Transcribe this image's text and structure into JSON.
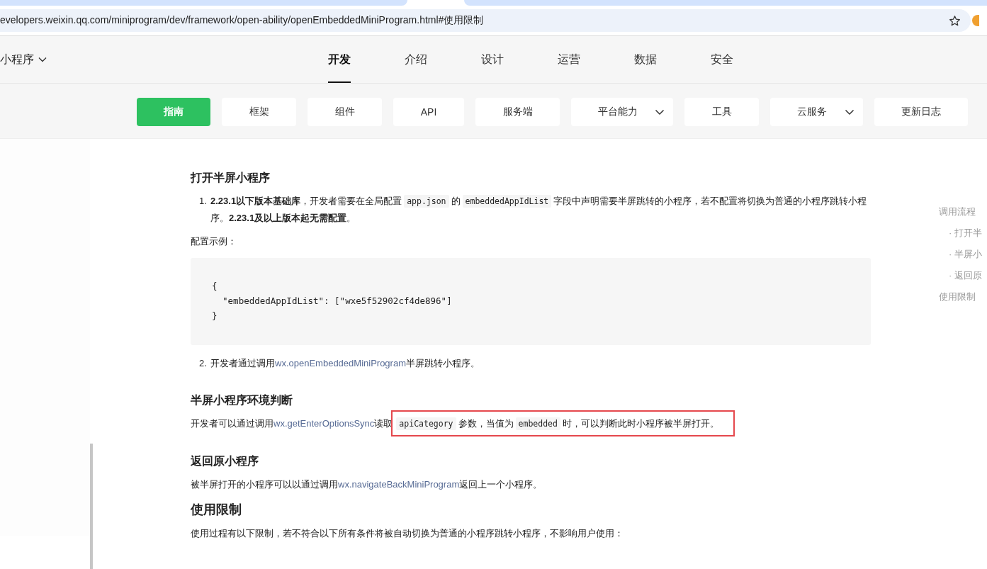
{
  "browser": {
    "url": "evelopers.weixin.qq.com/miniprogram/dev/framework/open-ability/openEmbeddedMiniProgram.html#使用限制"
  },
  "header": {
    "product": "小程序",
    "nav": [
      {
        "label": "开发",
        "selected": true
      },
      {
        "label": "介绍",
        "selected": false
      },
      {
        "label": "设计",
        "selected": false
      },
      {
        "label": "运营",
        "selected": false
      },
      {
        "label": "数据",
        "selected": false
      },
      {
        "label": "安全",
        "selected": false
      }
    ],
    "subnav": [
      {
        "label": "指南",
        "selected": true,
        "dropdown": false
      },
      {
        "label": "框架",
        "selected": false,
        "dropdown": false
      },
      {
        "label": "组件",
        "selected": false,
        "dropdown": false
      },
      {
        "label": "API",
        "selected": false,
        "dropdown": false
      },
      {
        "label": "服务端",
        "selected": false,
        "dropdown": false
      },
      {
        "label": "平台能力",
        "selected": false,
        "dropdown": true
      },
      {
        "label": "工具",
        "selected": false,
        "dropdown": false
      },
      {
        "label": "云服务",
        "selected": false,
        "dropdown": true
      },
      {
        "label": "更新日志",
        "selected": false,
        "dropdown": false
      }
    ]
  },
  "content": [
    {
      "kind": "h3",
      "text": "打开半屏小程序"
    },
    {
      "kind": "item",
      "number": "1.",
      "segments": [
        {
          "kind": "bold",
          "text": "2.23.1以下版本基础库"
        },
        {
          "kind": "text",
          "text": "，开发者需要在全局配置"
        },
        {
          "kind": "code",
          "text": "app.json"
        },
        {
          "kind": "text",
          "text": "的"
        },
        {
          "kind": "code",
          "text": "embeddedAppIdList"
        },
        {
          "kind": "text",
          "text": "字段中声明需要半屏跳转的小程序，若不配置将切换为普通的小程序跳转小程序。"
        },
        {
          "kind": "bold",
          "text": "2.23.1及以上版本起无需配置"
        },
        {
          "kind": "text",
          "text": "。"
        }
      ]
    },
    {
      "kind": "para",
      "segments": [
        {
          "kind": "text",
          "text": "配置示例："
        }
      ]
    },
    {
      "kind": "codeblock",
      "text": "{\n  \"embeddedAppIdList\": [\"wxe5f52902cf4de896\"]\n}"
    },
    {
      "kind": "item",
      "number": "2.",
      "segments": [
        {
          "kind": "text",
          "text": "开发者通过调用"
        },
        {
          "kind": "link",
          "text": "wx.openEmbeddedMiniProgram"
        },
        {
          "kind": "text",
          "text": "半屏跳转小程序。"
        }
      ]
    },
    {
      "kind": "h3",
      "text": "半屏小程序环境判断"
    },
    {
      "kind": "para",
      "segments": [
        {
          "kind": "text",
          "text": "开发者可以通过调用"
        },
        {
          "kind": "link",
          "text": "wx.getEnterOptionsSync"
        },
        {
          "kind": "text",
          "text": "读取"
        }
      ],
      "highlighted_segments": [
        {
          "kind": "code",
          "text": "apiCategory"
        },
        {
          "kind": "text",
          "text": "参数，当值为"
        },
        {
          "kind": "code",
          "text": "embedded"
        },
        {
          "kind": "text",
          "text": "时，可以判断此时小程序被半屏打开。"
        }
      ]
    },
    {
      "kind": "h3",
      "text": "返回原小程序"
    },
    {
      "kind": "para",
      "segments": [
        {
          "kind": "text",
          "text": "被半屏打开的小程序可以以通过调用"
        },
        {
          "kind": "link",
          "text": "wx.navigateBackMiniProgram"
        },
        {
          "kind": "text",
          "text": "返回上一个小程序。"
        }
      ]
    },
    {
      "kind": "h2",
      "text": "使用限制"
    },
    {
      "kind": "para",
      "segments": [
        {
          "kind": "text",
          "text": "使用过程有以下限制，若不符合以下所有条件将被自动切换为普通的小程序跳转小程序，不影响用户使用："
        }
      ]
    }
  ],
  "toc": [
    {
      "label": "调用流程",
      "children": [
        {
          "label": "· 打开半"
        },
        {
          "label": "· 半屏小"
        },
        {
          "label": "· 返回原"
        }
      ]
    },
    {
      "label": "使用限制"
    }
  ]
}
